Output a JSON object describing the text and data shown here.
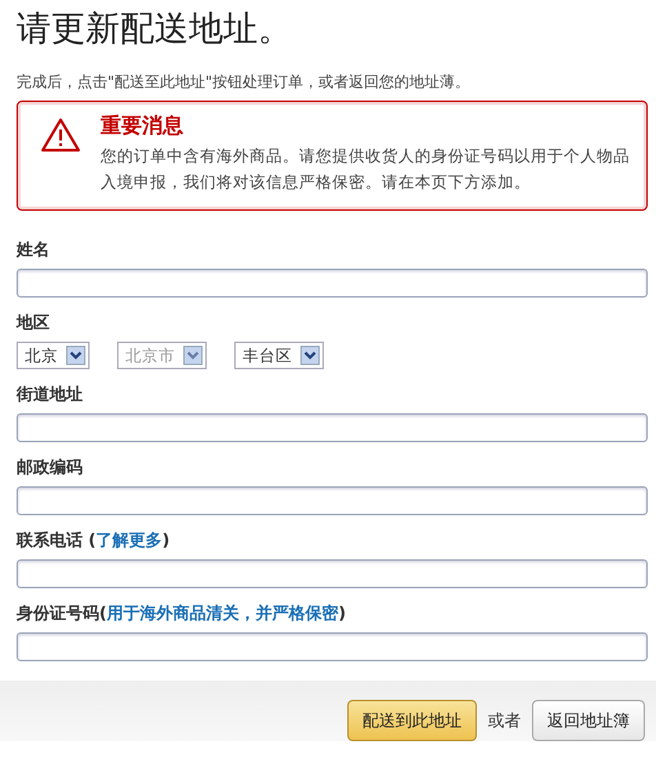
{
  "title": "请更新配送地址。",
  "instructions": "完成后，点击\"配送至此地址\"按钮处理订单，或者返回您的地址薄。",
  "alert": {
    "title": "重要消息",
    "message": "您的订单中含有海外商品。请您提供收货人的身份证号码以用于个人物品入境申报，我们将对该信息严格保密。请在本页下方添加。"
  },
  "fields": [
    {
      "kind": "text",
      "label": "姓名"
    },
    {
      "kind": "selects",
      "label": "地区",
      "selects": [
        {
          "value": "北京",
          "disabled": false
        },
        {
          "value": "北京市",
          "disabled": true
        },
        {
          "value": "丰台区",
          "disabled": false
        }
      ]
    },
    {
      "kind": "text",
      "label": "街道地址"
    },
    {
      "kind": "text",
      "label": "邮政编码"
    },
    {
      "kind": "text",
      "label": "联系电话 (",
      "link": "了解更多",
      "suffix": ")"
    },
    {
      "kind": "text",
      "label": "身份证号码(",
      "link": "用于海外商品清关，并严格保密",
      "suffix": ")"
    }
  ],
  "footer": {
    "primary_button": "配送到此地址",
    "separator": "或者",
    "secondary_button": "返回地址簿"
  }
}
